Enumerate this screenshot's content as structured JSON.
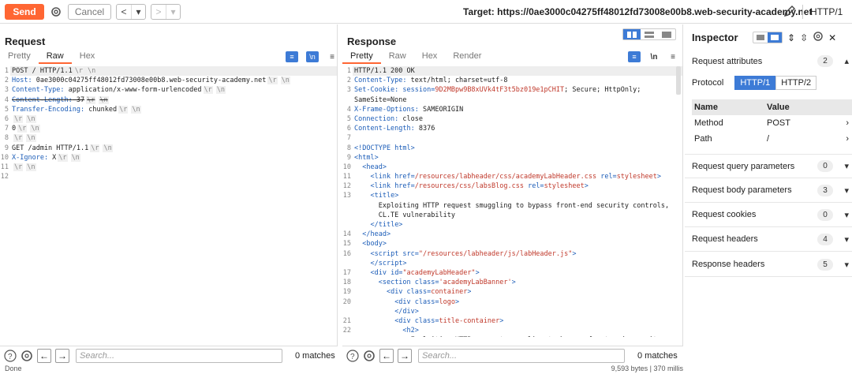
{
  "toolbar": {
    "send": "Send",
    "cancel": "Cancel",
    "target": "Target: https://0ae3000c04275ff48012fd73008e00b8.web-security-academy.net",
    "http_version": "HTTP/1"
  },
  "request": {
    "title": "Request",
    "tabs": [
      "Pretty",
      "Raw",
      "Hex"
    ],
    "active_tab": "Raw"
  },
  "response": {
    "title": "Response",
    "tabs": [
      "Pretty",
      "Raw",
      "Hex",
      "Render"
    ],
    "active_tab": "Pretty"
  },
  "search": {
    "placeholder": "Search...",
    "matches": "0 matches"
  },
  "inspector": {
    "title": "Inspector",
    "request_attributes": "Request attributes",
    "request_attributes_count": "2",
    "protocol_label": "Protocol",
    "protocol_options": [
      "HTTP/1",
      "HTTP/2"
    ],
    "columns": [
      "Name",
      "Value"
    ],
    "attributes": [
      {
        "name": "Method",
        "value": "POST"
      },
      {
        "name": "Path",
        "value": "/"
      }
    ],
    "sections": [
      {
        "label": "Request query parameters",
        "count": "0"
      },
      {
        "label": "Request body parameters",
        "count": "3"
      },
      {
        "label": "Request cookies",
        "count": "0"
      },
      {
        "label": "Request headers",
        "count": "4"
      },
      {
        "label": "Response headers",
        "count": "5"
      }
    ]
  },
  "statusbar": {
    "left": "Done",
    "right": "9,593 bytes | 370 millis"
  },
  "colors": {
    "accent": "#ff6633",
    "selected": "#3d7bd6"
  }
}
